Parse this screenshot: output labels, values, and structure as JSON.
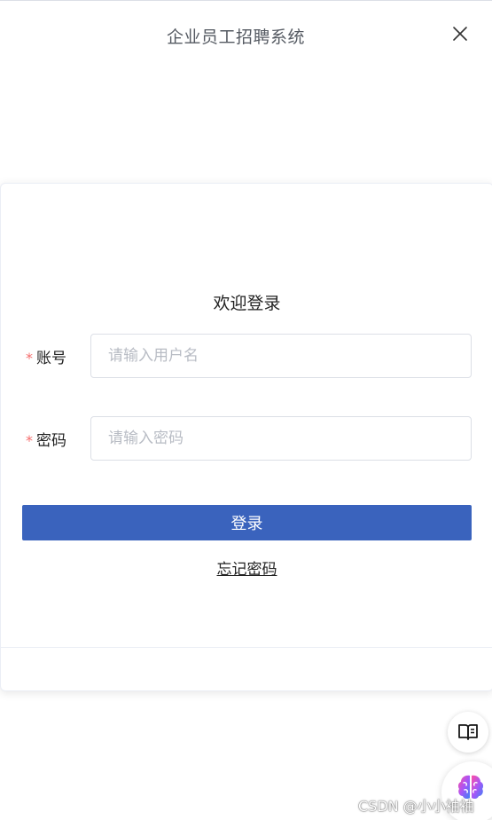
{
  "header": {
    "title": "企业员工招聘系统",
    "close_icon": "close-icon"
  },
  "login": {
    "welcome": "欢迎登录",
    "username": {
      "required_mark": "*",
      "label": "账号",
      "placeholder": "请输入用户名",
      "value": ""
    },
    "password": {
      "required_mark": "*",
      "label": "密码",
      "placeholder": "请输入密码",
      "value": ""
    },
    "submit_label": "登录",
    "forgot_label": "忘记密码"
  },
  "floating": {
    "read_icon": "book-open-icon",
    "assistant_icon": "brain-icon"
  },
  "watermark": "CSDN @小小袖袖",
  "colors": {
    "primary": "#3a63bd",
    "required": "#f56c6c",
    "placeholder": "#b8bcc4",
    "border": "#dcdfe6"
  }
}
